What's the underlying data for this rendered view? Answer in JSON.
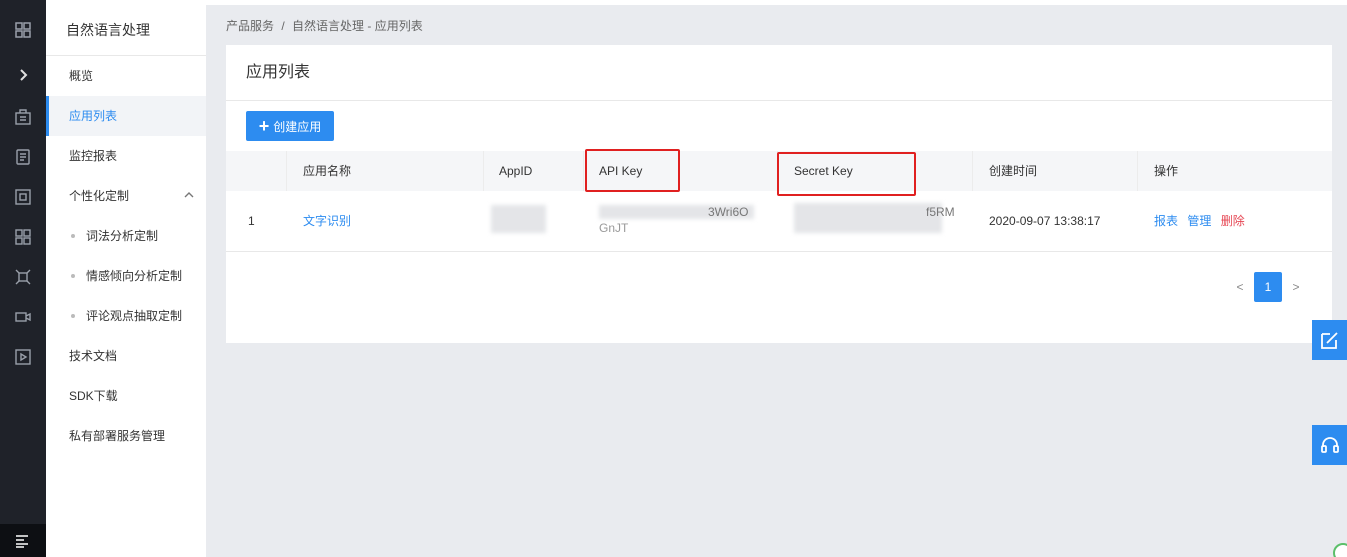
{
  "rail": {
    "icons": [
      "grid-icon",
      "chevron-right-icon",
      "building-icon",
      "clipboard-icon",
      "frame-icon",
      "apps-icon",
      "nodes-icon",
      "video-icon",
      "play-icon",
      "menu-icon"
    ]
  },
  "sidebar": {
    "title": "自然语言处理",
    "items": [
      {
        "label": "概览"
      },
      {
        "label": "应用列表"
      },
      {
        "label": "监控报表"
      },
      {
        "label": "个性化定制"
      },
      {
        "label": "词法分析定制"
      },
      {
        "label": "情感倾向分析定制"
      },
      {
        "label": "评论观点抽取定制"
      },
      {
        "label": "技术文档"
      },
      {
        "label": "SDK下载"
      },
      {
        "label": "私有部署服务管理"
      }
    ]
  },
  "breadcrumb": {
    "root": "产品服务",
    "sep": "/",
    "current": "自然语言处理 - 应用列表"
  },
  "main": {
    "title": "应用列表",
    "create_label": "创建应用",
    "columns": [
      "应用名称",
      "AppID",
      "API Key",
      "Secret Key",
      "创建时间",
      "操作"
    ],
    "rows": [
      {
        "index": "1",
        "name": "文字识别",
        "api_key_visible": "3Wri6O",
        "api_key_visible2": "GnJT",
        "secret_key_visible": "f5RM",
        "created": "2020-09-07 13:38:17",
        "action_report": "报表",
        "action_manage": "管理",
        "action_delete": "删除"
      }
    ],
    "pagination": {
      "prev": "<",
      "current": "1",
      "next": ">"
    }
  },
  "colors": {
    "accent": "#2d8cf0",
    "danger": "#e64552",
    "highlight_box": "#e02020",
    "rail": "#1f2229"
  }
}
